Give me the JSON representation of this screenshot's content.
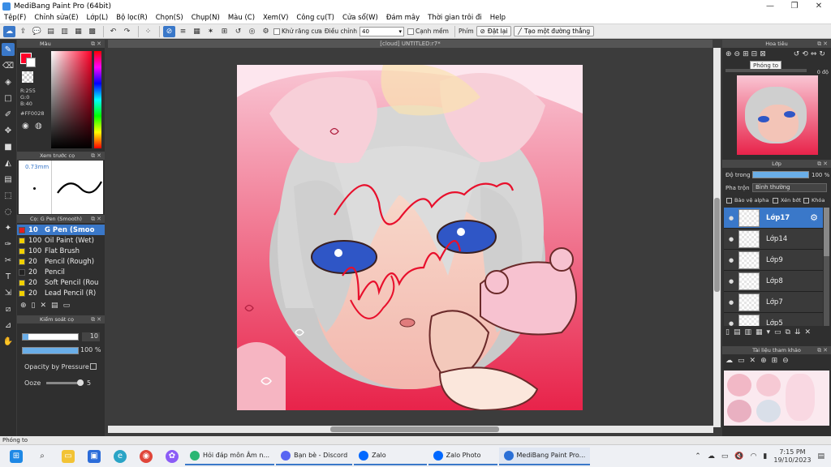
{
  "window": {
    "title": "MediBang Paint Pro (64bit)"
  },
  "menu": [
    "Tệp(F)",
    "Chỉnh sửa(E)",
    "Lớp(L)",
    "Bộ lọc(R)",
    "Chọn(S)",
    "Chụp(N)",
    "Màu (C)",
    "Xem(V)",
    "Công cụ(T)",
    "Cửa sổ(W)",
    "Đám mây",
    "Thời gian trôi đi",
    "Help"
  ],
  "toolbar": {
    "antialias": "Khử răng cưa",
    "adjust_label": "Điều chỉnh",
    "adjust_value": "40",
    "edge": "Cạnh mềm",
    "shortcut": "Phím",
    "reset": "Đặt lại",
    "make_line": "Tạo một đường thẳng"
  },
  "color_panel": {
    "title": "Màu",
    "r": "R:255",
    "g": "G:0",
    "b": "B:40",
    "hex": "#FF0028",
    "primary": "#ff0028"
  },
  "preview_panel": {
    "title": "Xem trước cọ",
    "size": "0.73mm"
  },
  "brush_panel": {
    "title": "Cọ: G Pen (Smooth)",
    "brushes": [
      {
        "size": "10",
        "name": "G Pen (Smoo",
        "color": "#e02020"
      },
      {
        "size": "100",
        "name": "Oil Paint (Wet)",
        "color": "#f0d000"
      },
      {
        "size": "100",
        "name": "Flat Brush",
        "color": "#f0d000"
      },
      {
        "size": "20",
        "name": "Pencil (Rough)",
        "color": "#f0d000"
      },
      {
        "size": "20",
        "name": "Pencil",
        "color": "#222222"
      },
      {
        "size": "20",
        "name": "Soft Pencil (Rou",
        "color": "#f0d000"
      },
      {
        "size": "20",
        "name": "Lead Pencil (R)",
        "color": "#f0d000"
      }
    ]
  },
  "brush_control": {
    "title": "Kiểm soát cọ",
    "size": "10",
    "opacity": "100 %",
    "opacity_pressure": "Opacity by Pressure",
    "ooze_label": "Ooze",
    "ooze_value": "5"
  },
  "document": {
    "tab": "[cloud] UNTITLED:r7*"
  },
  "navigator": {
    "title": "Hoa tiêu",
    "tooltip": "Phóng to",
    "rotation": "0 độ"
  },
  "layer_panel": {
    "title": "Lớp",
    "opacity_label": "Độ trong",
    "opacity_value": "100 %",
    "blend_label": "Pha trộn",
    "blend_value": "Bình thường",
    "protect_alpha": "Bảo vệ alpha",
    "clipping": "Xén bớt",
    "lock": "Khóa",
    "layers": [
      "Lớp17",
      "Lớp14",
      "Lớp9",
      "Lớp8",
      "Lớp7",
      "Lớp5"
    ]
  },
  "reference_panel": {
    "title": "Tài liệu tham khảo"
  },
  "status": {
    "text": "Phóng to"
  },
  "taskbar": {
    "apps": [
      {
        "label": "Hỏi đáp môn Âm n...",
        "color": "#2bb673"
      },
      {
        "label": "Bạn bè - Discord",
        "color": "#5865f2"
      },
      {
        "label": "Zalo",
        "color": "#0068ff"
      },
      {
        "label": "Zalo Photo",
        "color": "#0068ff"
      },
      {
        "label": "MediBang Paint Pro...",
        "color": "#2a6fd6"
      }
    ],
    "time": "7:15 PM",
    "date": "19/10/2023"
  }
}
